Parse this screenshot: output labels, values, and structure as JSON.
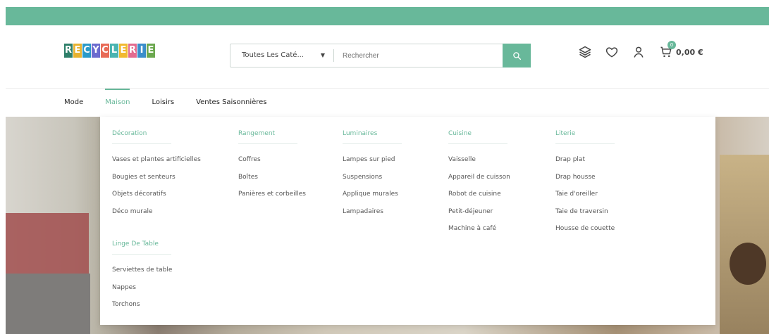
{
  "brand": {
    "logo_text": "RECYCLERIE",
    "logo_colors": [
      "#2e7f6a",
      "#e7b22f",
      "#2a9ac8",
      "#6b6bcf",
      "#e86b57",
      "#4ab4b1",
      "#f1b92f",
      "#e36b90",
      "#3b8ecb",
      "#6ca84f"
    ]
  },
  "search": {
    "category": "Toutes Les Caté...",
    "placeholder": "Rechercher"
  },
  "header": {
    "cart_count": "0",
    "cart_total": "0,00 €"
  },
  "nav": {
    "items": [
      {
        "label": "Mode"
      },
      {
        "label": "Maison"
      },
      {
        "label": "Loisirs"
      },
      {
        "label": "Ventes Saisonnières"
      }
    ]
  },
  "mega": {
    "columns": [
      {
        "title": "Décoration",
        "items": [
          "Vases et plantes artificielles",
          "Bougies et senteurs",
          "Objets décoratifs",
          "Déco murale"
        ]
      },
      {
        "title": "Rangement",
        "items": [
          "Coffres",
          "Boîtes",
          "Panières et corbeilles"
        ]
      },
      {
        "title": "Luminaires",
        "items": [
          "Lampes sur pied",
          "Suspensions",
          "Applique murales",
          "Lampadaires"
        ]
      },
      {
        "title": "Cuisine",
        "items": [
          "Vaisselle",
          "Appareil de cuisson",
          "Robot de cuisine",
          "Petit-déjeuner",
          "Machine à café"
        ]
      },
      {
        "title": "Literie",
        "items": [
          "Drap plat",
          "Drap housse",
          "Taie d'oreiller",
          "Taie de traversin",
          "Housse de couette"
        ]
      }
    ],
    "extra": {
      "title": "Linge De Table",
      "items": [
        "Serviettes de table",
        "Nappes",
        "Torchons"
      ]
    }
  },
  "colors": {
    "accent": "#68b89a",
    "text": "#222",
    "muted": "#555"
  },
  "icons": [
    "search-icon",
    "layers-icon",
    "heart-icon",
    "user-icon",
    "cart-icon"
  ]
}
